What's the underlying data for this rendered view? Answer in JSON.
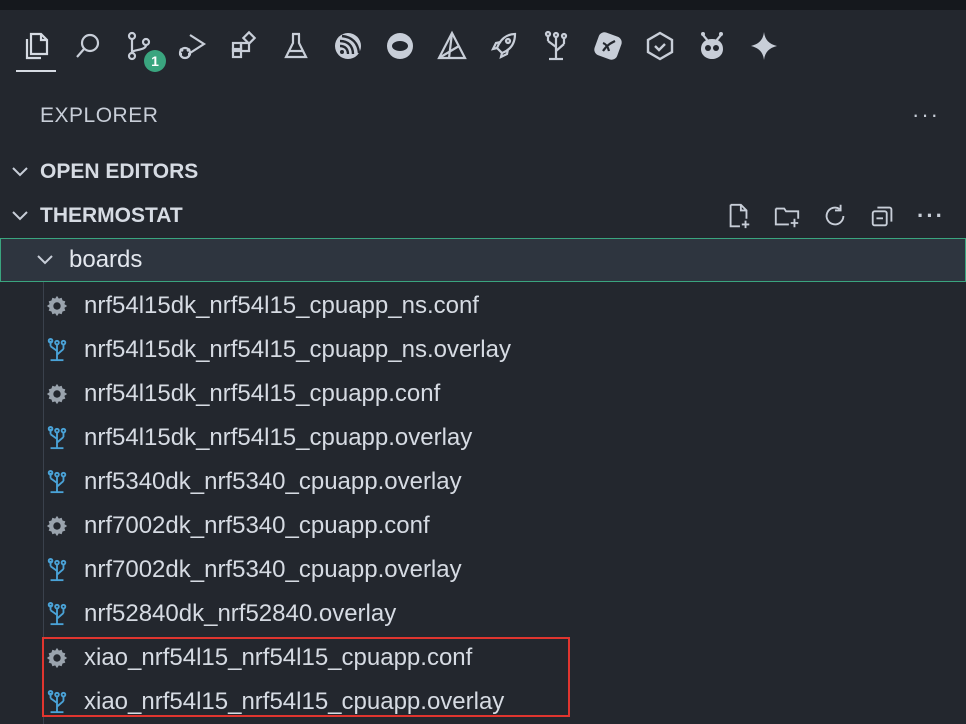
{
  "activity_bar": [
    {
      "name": "explorer-icon",
      "active": true
    },
    {
      "name": "search-icon"
    },
    {
      "name": "source-control-icon",
      "badge": "1"
    },
    {
      "name": "run-debug-icon"
    },
    {
      "name": "extensions-icon"
    },
    {
      "name": "testing-icon"
    },
    {
      "name": "espressif-icon"
    },
    {
      "name": "remote-icon"
    },
    {
      "name": "nrf-connect-icon"
    },
    {
      "name": "rocket-icon"
    },
    {
      "name": "device-tree-icon"
    },
    {
      "name": "git-graph-icon"
    },
    {
      "name": "copilot-icon"
    },
    {
      "name": "platformio-icon"
    },
    {
      "name": "sparkle-icon"
    }
  ],
  "explorer": {
    "title": "EXPLORER",
    "more": "···"
  },
  "sections": {
    "open_editors": "OPEN EDITORS",
    "workspace": "THERMOSTAT"
  },
  "folder": {
    "name": "boards"
  },
  "files": [
    {
      "name": "nrf54l15dk_nrf54l15_cpuapp_ns.conf",
      "type": "conf"
    },
    {
      "name": "nrf54l15dk_nrf54l15_cpuapp_ns.overlay",
      "type": "overlay"
    },
    {
      "name": "nrf54l15dk_nrf54l15_cpuapp.conf",
      "type": "conf"
    },
    {
      "name": "nrf54l15dk_nrf54l15_cpuapp.overlay",
      "type": "overlay"
    },
    {
      "name": "nrf5340dk_nrf5340_cpuapp.overlay",
      "type": "overlay"
    },
    {
      "name": "nrf7002dk_nrf5340_cpuapp.conf",
      "type": "conf"
    },
    {
      "name": "nrf7002dk_nrf5340_cpuapp.overlay",
      "type": "overlay"
    },
    {
      "name": "nrf52840dk_nrf52840.overlay",
      "type": "overlay"
    },
    {
      "name": "xiao_nrf54l15_nrf54l15_cpuapp.conf",
      "type": "conf"
    },
    {
      "name": "xiao_nrf54l15_nrf54l15_cpuapp.overlay",
      "type": "overlay"
    }
  ],
  "colors": {
    "background": "#23272e",
    "accent": "#3aa57f",
    "highlight": "#e0352f",
    "overlay_icon": "#4aa3d8",
    "conf_icon": "#9aa3ad"
  }
}
